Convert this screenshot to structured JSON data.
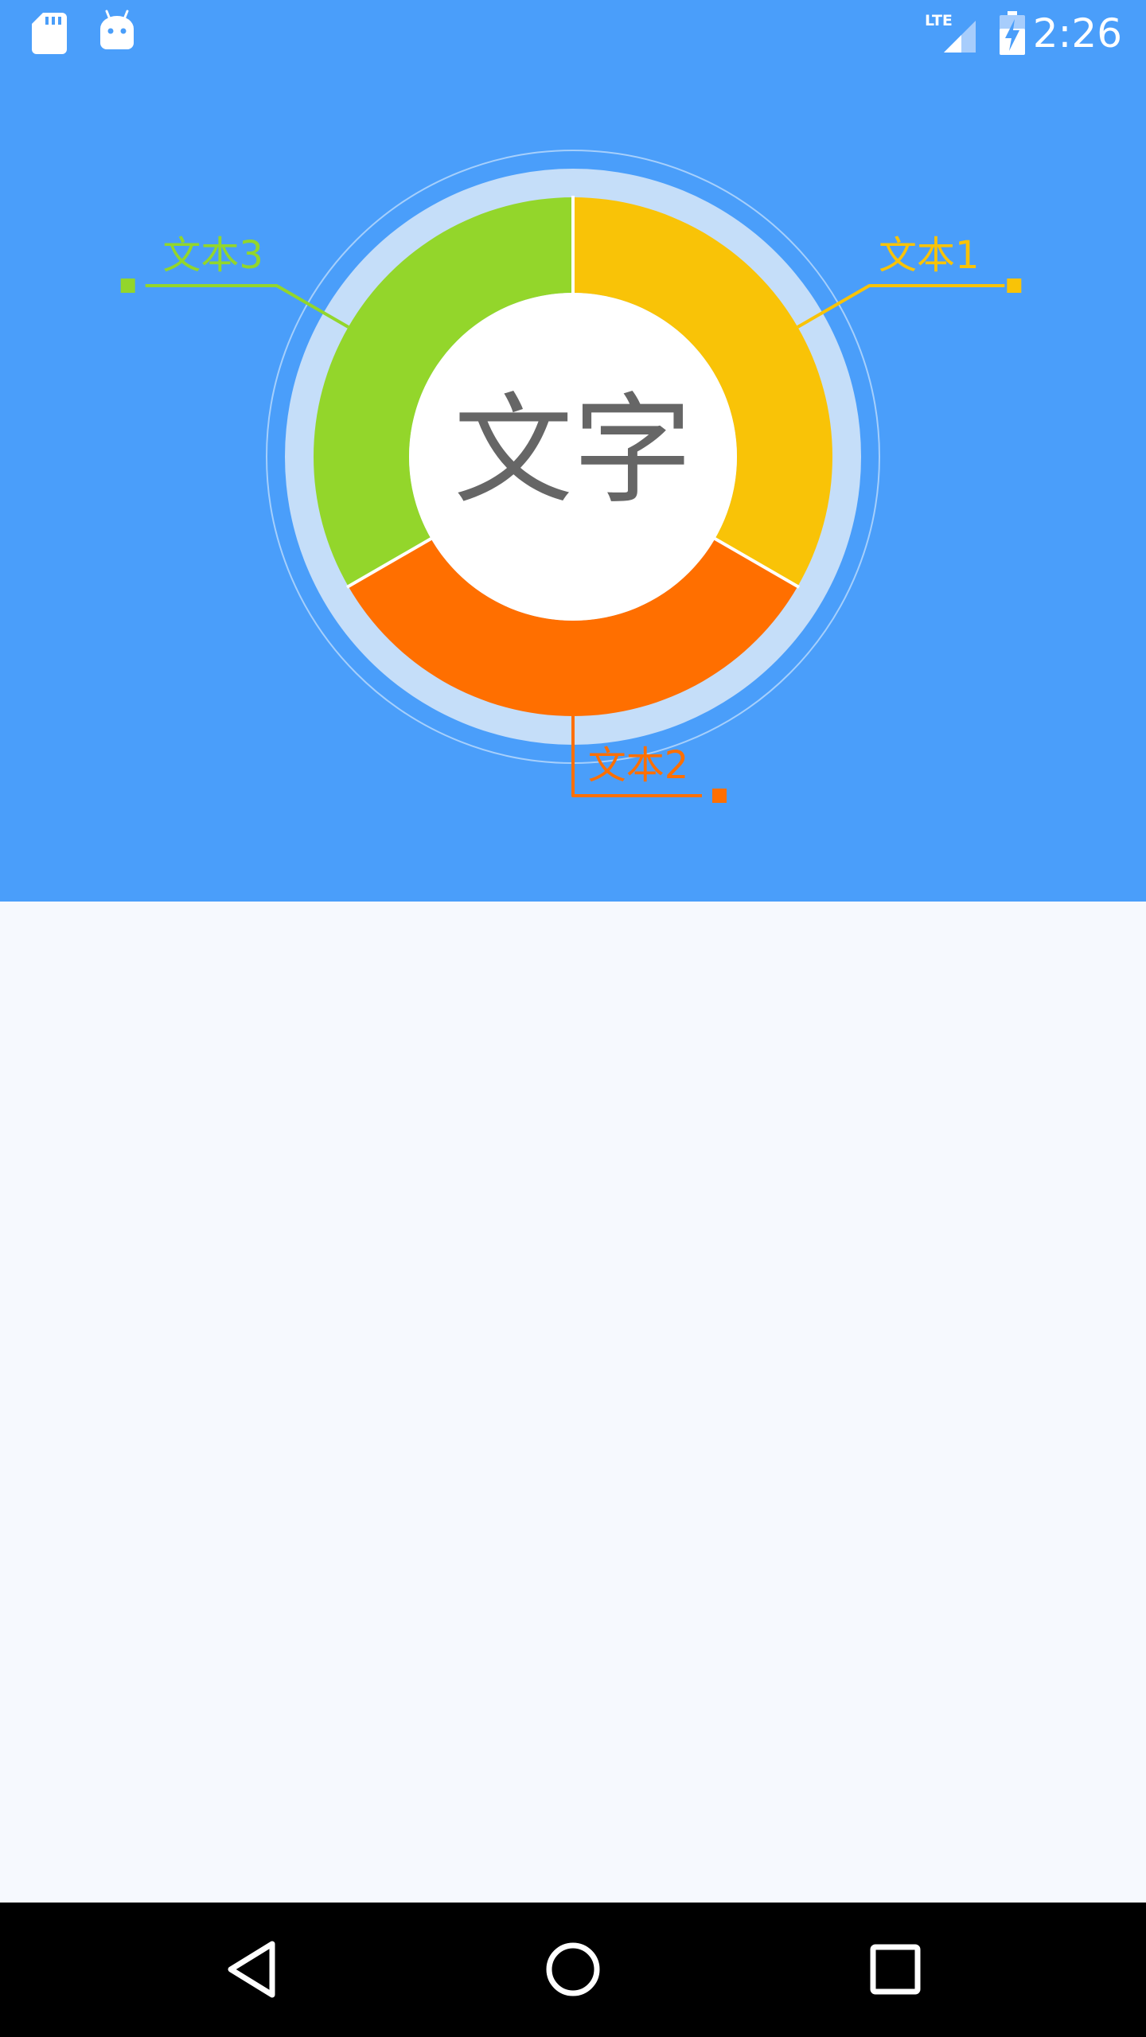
{
  "status_bar": {
    "time": "2:26",
    "network": "LTE",
    "left_icons": [
      "sd-card-icon",
      "android-icon"
    ],
    "right_icons": [
      "lte-signal-icon",
      "battery-charging-icon"
    ]
  },
  "theme": {
    "header_bg": "#4a9efa",
    "content_bg": "#f6f9fe",
    "nav_bg": "#000000"
  },
  "chart_data": {
    "type": "pie",
    "center_label": "文字",
    "slices": [
      {
        "label": "文本1",
        "value": 1,
        "color": "#f9c307"
      },
      {
        "label": "文本2",
        "value": 1,
        "color": "#ff6f00"
      },
      {
        "label": "文本3",
        "value": 1,
        "color": "#93d62b"
      }
    ],
    "start_angle_deg": 0,
    "direction": "clockwise",
    "legend": "callout-lines"
  },
  "nav_bar": {
    "buttons": [
      "back-icon",
      "home-icon",
      "recents-icon"
    ]
  }
}
